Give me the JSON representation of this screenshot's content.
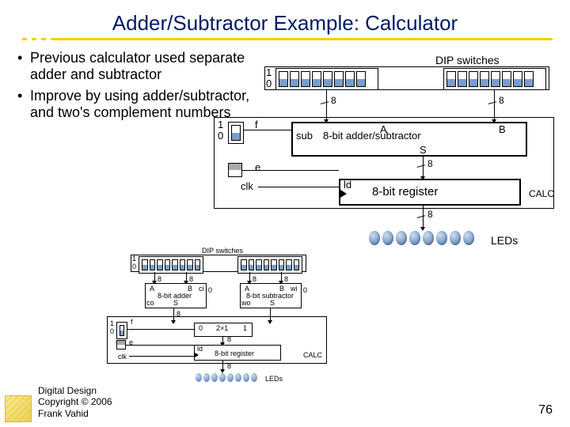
{
  "title": "Adder/Subtractor Example: Calculator",
  "bullets": [
    "Previous calculator used separate adder and subtractor",
    "Improve by using adder/subtractor, and two's complement numbers"
  ],
  "main": {
    "dip": "DIP switches",
    "one": "1",
    "zero": "0",
    "eight": "8",
    "f": "f",
    "e": "e",
    "clk": "clk",
    "A": "A",
    "B": "B",
    "sub": "sub",
    "addsub": "8-bit adder/subtractor",
    "S": "S",
    "ld": "ld",
    "reg": "8-bit register",
    "calc": "CALC",
    "leds": "LEDs"
  },
  "small": {
    "dip": "DIP switches",
    "one": "1",
    "zero": "0",
    "eight": "8",
    "A": "A",
    "B": "B",
    "ci": "ci",
    "co": "co",
    "adder": "8-bit adder",
    "S": "S",
    "subtractor": "8-bit subtractor",
    "wi": "wi",
    "wo": "wo",
    "mux0": "0",
    "mux": "2×1",
    "mux1": "1",
    "ld": "ld",
    "reg": "8-bit register",
    "calc": "CALC",
    "leds": "LEDs",
    "f": "f",
    "e": "e",
    "clk": "clk"
  },
  "footer": {
    "l1": "Digital Design",
    "l2": "Copyright © 2006",
    "l3": "Frank Vahid"
  },
  "page": "76"
}
